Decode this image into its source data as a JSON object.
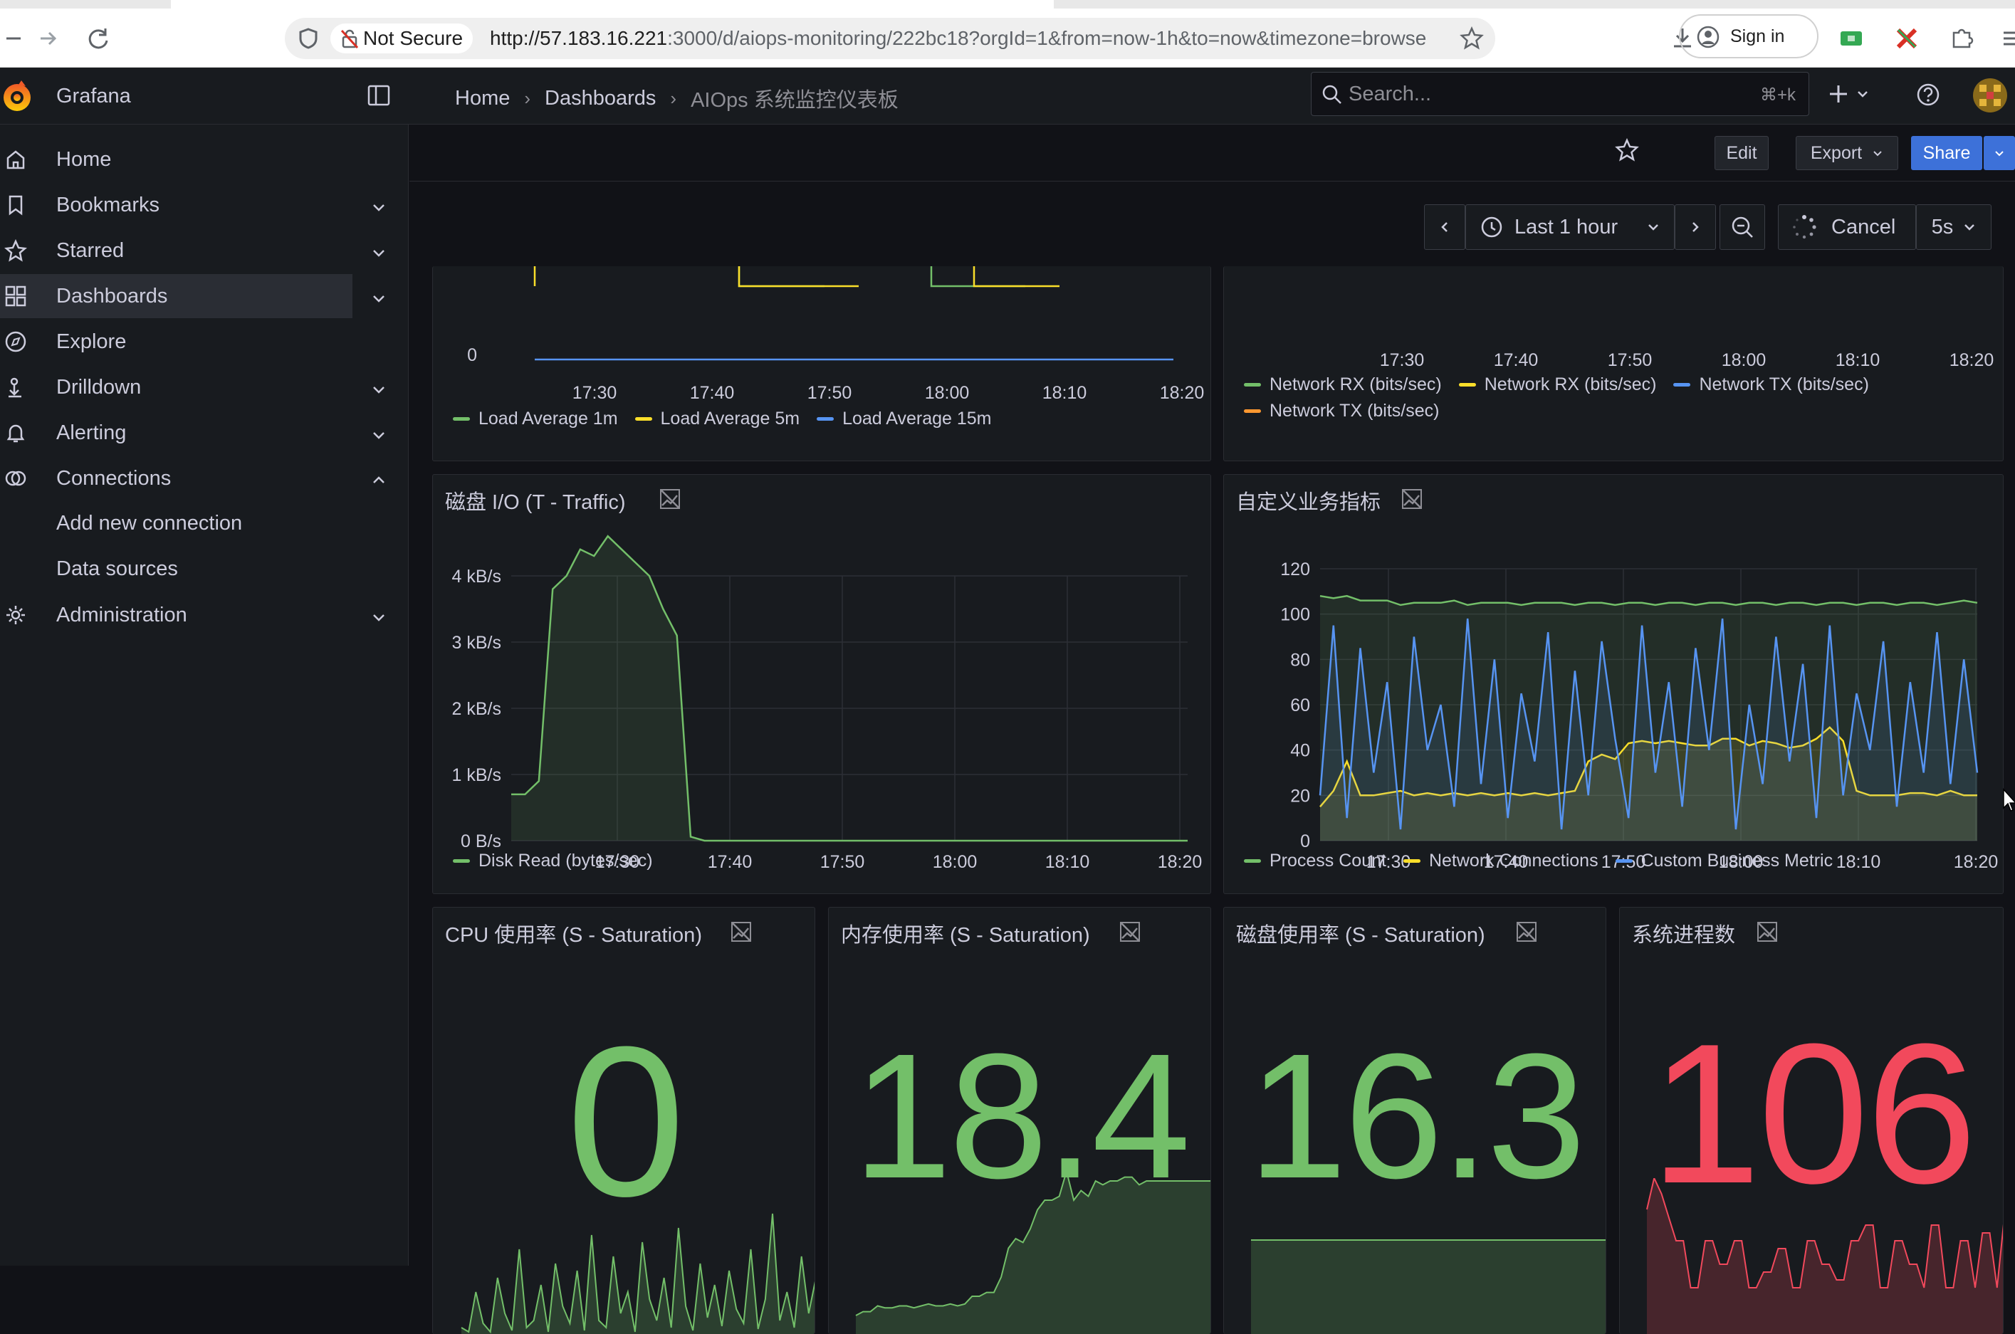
{
  "browser": {
    "not_secure": "Not Secure",
    "url_host": "http://57.183.16.221",
    "url_rest": ":3000/d/aiops-monitoring/222bc18?orgId=1&from=now-1h&to=now&timezone=browse",
    "sign_in": "Sign in"
  },
  "colors": {
    "green": "#73bf69",
    "yellow": "#fade2a",
    "blue": "#5794f2",
    "orange": "#ff9830",
    "red": "#f2495c",
    "primary": "#3d71d9"
  },
  "grafana": {
    "app_title": "Grafana",
    "breadcrumb": [
      "Home",
      "Dashboards",
      "AIOps 系统监控仪表板"
    ],
    "search_placeholder": "Search...",
    "search_shortcut": "⌘+k",
    "toolbar": {
      "edit": "Edit",
      "export": "Export",
      "share": "Share"
    },
    "time_range": "Last 1 hour",
    "cancel": "Cancel",
    "refresh_interval": "5s"
  },
  "sidebar": {
    "items": [
      {
        "label": "Home",
        "icon": "home-icon",
        "chevron": ""
      },
      {
        "label": "Bookmarks",
        "icon": "bookmark-icon",
        "chevron": "down"
      },
      {
        "label": "Starred",
        "icon": "star-icon",
        "chevron": "down"
      },
      {
        "label": "Dashboards",
        "icon": "dashboards-icon",
        "chevron": "down",
        "active": true
      },
      {
        "label": "Explore",
        "icon": "compass-icon",
        "chevron": ""
      },
      {
        "label": "Drilldown",
        "icon": "drilldown-icon",
        "chevron": "down"
      },
      {
        "label": "Alerting",
        "icon": "bell-icon",
        "chevron": "down"
      },
      {
        "label": "Connections",
        "icon": "connections-icon",
        "chevron": "up"
      }
    ],
    "sub_items": [
      "Add new connection",
      "Data sources"
    ],
    "admin": {
      "label": "Administration",
      "icon": "gear-icon",
      "chevron": "down"
    }
  },
  "chart_data": [
    {
      "type": "line",
      "panel": "load-average",
      "y_ticks": [
        "0"
      ],
      "x_ticks": [
        "17:30",
        "17:40",
        "17:50",
        "18:00",
        "18:10",
        "18:20"
      ],
      "series": [
        {
          "name": "Load Average 1m",
          "color": "#73bf69"
        },
        {
          "name": "Load Average 5m",
          "color": "#fade2a"
        },
        {
          "name": "Load Average 15m",
          "color": "#5794f2"
        }
      ]
    },
    {
      "type": "line",
      "panel": "network",
      "x_ticks": [
        "17:30",
        "17:40",
        "17:50",
        "18:00",
        "18:10",
        "18:20"
      ],
      "series": [
        {
          "name": "Network RX (bits/sec)",
          "color": "#73bf69"
        },
        {
          "name": "Network RX (bits/sec)",
          "color": "#fade2a"
        },
        {
          "name": "Network TX (bits/sec)",
          "color": "#5794f2"
        },
        {
          "name": "Network TX (bits/sec)",
          "color": "#ff9830"
        }
      ]
    },
    {
      "type": "area",
      "title": "磁盘 I/O (T - Traffic)",
      "y_ticks": [
        "0 B/s",
        "1 kB/s",
        "2 kB/s",
        "3 kB/s",
        "4 kB/s"
      ],
      "ylim": [
        0,
        4000
      ],
      "x_ticks": [
        "17:30",
        "17:40",
        "17:50",
        "18:00",
        "18:10",
        "18:20"
      ],
      "series": [
        {
          "name": "Disk Read (bytes/sec)",
          "color": "#73bf69",
          "values": [
            700,
            700,
            900,
            3800,
            4000,
            4400,
            4300,
            4600,
            4400,
            4200,
            4000,
            3500,
            3100,
            60,
            0,
            0,
            0,
            0,
            0,
            0,
            0,
            0,
            0,
            0,
            0,
            0,
            0,
            0,
            0,
            0,
            0,
            0,
            0,
            0,
            0,
            0,
            0,
            0,
            0,
            0,
            0,
            0,
            0,
            0,
            0,
            0,
            0,
            0,
            0,
            0
          ]
        }
      ]
    },
    {
      "type": "line",
      "title": "自定义业务指标",
      "y_ticks": [
        "0",
        "20",
        "40",
        "60",
        "80",
        "100",
        "120"
      ],
      "ylim": [
        0,
        120
      ],
      "x_ticks": [
        "17:30",
        "17:40",
        "17:50",
        "18:00",
        "18:10",
        "18:20"
      ],
      "series": [
        {
          "name": "Process Count",
          "color": "#73bf69",
          "values": [
            108,
            107,
            108,
            106,
            106,
            106,
            104,
            105,
            105,
            105,
            106,
            104,
            105,
            105,
            105,
            104,
            105,
            105,
            105,
            104,
            105,
            105,
            104,
            105,
            105,
            104,
            105,
            105,
            104,
            105,
            105,
            104,
            105,
            105,
            104,
            105,
            105,
            104,
            105,
            105,
            104,
            105,
            105,
            104,
            105,
            105,
            104,
            105,
            106,
            105
          ]
        },
        {
          "name": "Network Connections",
          "color": "#fade2a",
          "values": [
            15,
            22,
            35,
            20,
            20,
            21,
            22,
            20,
            21,
            20,
            21,
            20,
            21,
            20,
            21,
            20,
            21,
            20,
            21,
            22,
            35,
            38,
            36,
            43,
            44,
            43,
            44,
            43,
            42,
            42,
            45,
            45,
            42,
            44,
            43,
            41,
            42,
            45,
            50,
            44,
            22,
            20,
            20,
            20,
            21,
            21,
            20,
            22,
            20,
            20
          ]
        },
        {
          "name": "Custom Business Metric",
          "color": "#5794f2",
          "values": [
            20,
            95,
            10,
            85,
            30,
            70,
            5,
            90,
            40,
            60,
            15,
            98,
            25,
            80,
            10,
            65,
            35,
            92,
            5,
            75,
            20,
            88,
            45,
            10,
            95,
            30,
            70,
            15,
            85,
            40,
            98,
            5,
            60,
            25,
            90,
            35,
            78,
            10,
            95,
            20,
            65,
            40,
            88,
            15,
            70,
            30,
            92,
            25,
            80,
            30
          ]
        }
      ]
    }
  ],
  "stat_panels": [
    {
      "title": "CPU 使用率 (S - Saturation)",
      "value": "0",
      "color": "#73bf69",
      "spark": [
        5,
        2,
        30,
        8,
        2,
        40,
        15,
        3,
        60,
        5,
        10,
        35,
        2,
        50,
        20,
        8,
        45,
        3,
        70,
        10,
        5,
        55,
        15,
        30,
        2,
        65,
        25,
        10,
        40,
        5,
        75,
        20,
        3,
        50,
        12,
        35,
        6,
        45,
        18,
        8,
        60,
        4,
        25,
        85,
        10,
        30,
        5,
        55,
        15,
        40
      ]
    },
    {
      "title": "内存使用率 (S - Saturation)",
      "value": "18.4",
      "color": "#73bf69",
      "spark": [
        10,
        12,
        12,
        15,
        14,
        14,
        15,
        15,
        14,
        15,
        16,
        15,
        15,
        16,
        15,
        16,
        20,
        20,
        22,
        22,
        30,
        45,
        50,
        48,
        55,
        65,
        70,
        70,
        72,
        85,
        70,
        75,
        72,
        80,
        78,
        80,
        80,
        82,
        82,
        78,
        80,
        80,
        80,
        80,
        80,
        80,
        80,
        80,
        80,
        80
      ]
    },
    {
      "title": "磁盘使用率 (S - Saturation)",
      "value": "16.3",
      "color": "#73bf69",
      "spark": [
        70,
        70,
        70,
        70,
        70,
        70,
        70,
        70,
        70,
        70,
        70,
        70,
        70,
        70,
        70,
        70,
        70,
        70,
        70,
        70,
        70,
        70,
        70,
        70,
        70,
        70,
        70,
        70,
        70,
        70,
        70,
        70,
        70,
        70,
        70,
        70,
        70,
        70,
        70,
        70,
        70,
        70,
        70,
        70,
        70,
        70,
        70,
        70,
        70,
        70
      ]
    },
    {
      "title": "系统进程数",
      "value": "106",
      "color": "#f2495c",
      "spark": [
        80,
        100,
        90,
        75,
        60,
        60,
        30,
        30,
        60,
        60,
        45,
        45,
        60,
        60,
        30,
        30,
        40,
        40,
        55,
        55,
        30,
        30,
        60,
        60,
        45,
        45,
        35,
        35,
        60,
        60,
        70,
        70,
        30,
        30,
        60,
        60,
        45,
        45,
        30,
        70,
        70,
        30,
        30,
        60,
        60,
        30,
        65,
        65,
        30,
        75
      ]
    }
  ]
}
